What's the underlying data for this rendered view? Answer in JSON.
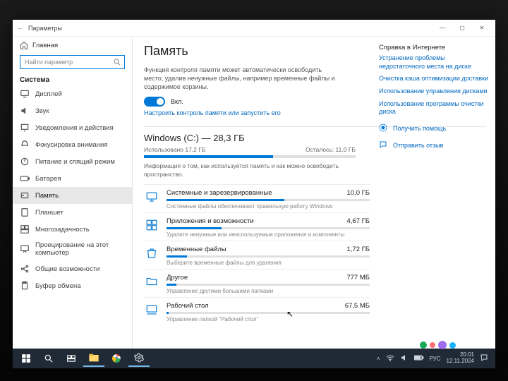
{
  "window": {
    "title": "Параметры"
  },
  "win_controls": {
    "min": "—",
    "max": "▢",
    "close": "✕"
  },
  "sidebar": {
    "home": "Главная",
    "search_placeholder": "Найти параметр",
    "heading": "Система",
    "items": [
      {
        "icon": "display-icon",
        "label": "Дисплей"
      },
      {
        "icon": "sound-icon",
        "label": "Звук"
      },
      {
        "icon": "notify-icon",
        "label": "Уведомления и действия"
      },
      {
        "icon": "focus-icon",
        "label": "Фокусировка внимания"
      },
      {
        "icon": "power-icon",
        "label": "Питание и спящий режим"
      },
      {
        "icon": "battery-icon",
        "label": "Батарея"
      },
      {
        "icon": "storage-icon",
        "label": "Память"
      },
      {
        "icon": "tablet-icon",
        "label": "Планшет"
      },
      {
        "icon": "multitask-icon",
        "label": "Многозадачность"
      },
      {
        "icon": "project-icon",
        "label": "Проецирование на этот компьютер"
      },
      {
        "icon": "shared-icon",
        "label": "Общие возможности"
      },
      {
        "icon": "clipboard-icon",
        "label": "Буфер обмена"
      }
    ],
    "active_index": 6
  },
  "main": {
    "title": "Память",
    "sense_desc": "Функция контроля памяти может автоматически освободить место, удалив ненужные файлы, например временные файлы и содержимое корзины.",
    "toggle_state": "Вкл.",
    "configure_link": "Настроить контроль памяти или запустить его",
    "drive": {
      "title": "Windows (C:) — 28,3 ГБ",
      "used_label": "Использовано 17,2 ГБ",
      "free_label": "Осталось: 11,0 ГБ",
      "fill_pct": 61,
      "desc": "Информация о том, как используется память и как можно освободить пространство."
    },
    "categories": [
      {
        "icon": "system-icon",
        "name": "Системные и зарезервированные",
        "size": "10,0 ГБ",
        "pct": 58,
        "sub": "Системные файлы обеспечивают правильную работу Windows"
      },
      {
        "icon": "apps-icon",
        "name": "Приложения и возможности",
        "size": "4,67 ГБ",
        "pct": 27,
        "sub": "Удалите ненужные или неиспользуемые приложения и компоненты"
      },
      {
        "icon": "trash-icon",
        "name": "Временные файлы",
        "size": "1,72 ГБ",
        "pct": 10,
        "sub": "Выберите временные файлы для удаления"
      },
      {
        "icon": "other-icon",
        "name": "Другое",
        "size": "777 МБ",
        "pct": 5,
        "sub": "Управление другими большими папками"
      },
      {
        "icon": "desktop-icon",
        "name": "Рабочий стол",
        "size": "67,5 МБ",
        "pct": 1,
        "sub": "Управление папкой \"Рабочий стол\""
      }
    ]
  },
  "right": {
    "heading": "Справка в Интернете",
    "links": [
      "Устранение проблемы недостаточного места на диске",
      "Очистка кэша оптимизации доставки",
      "Использование управления дисками",
      "Использование программы очистки диска"
    ],
    "help": "Получить помощь",
    "feedback": "Отправить отзыв"
  },
  "taskbar": {
    "lang": "РУС",
    "time": "20:01",
    "date": "12.11.2024"
  },
  "watermark": "Avito"
}
